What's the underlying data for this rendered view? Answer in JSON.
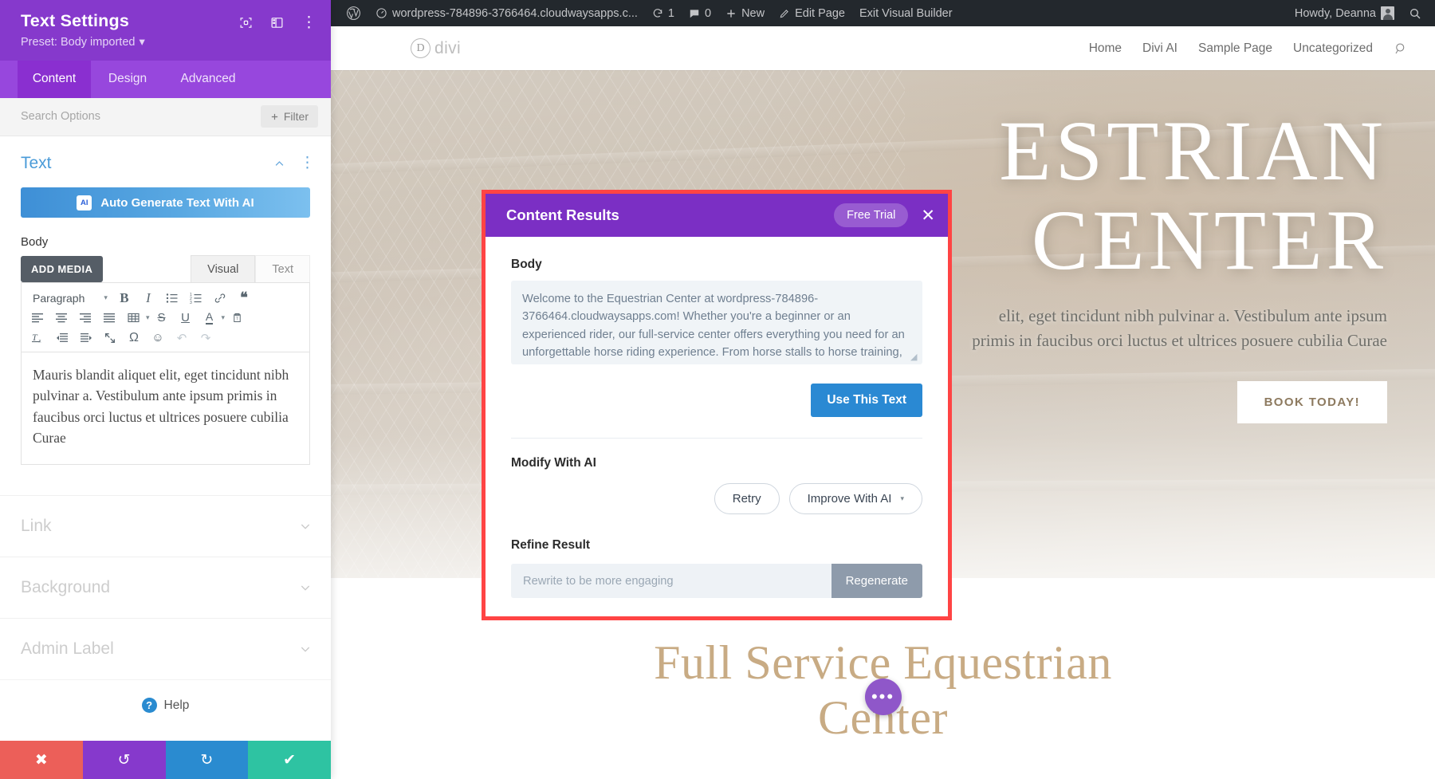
{
  "wp_adminbar": {
    "logo_icon": "wordpress-icon",
    "site_icon": "dashboard-icon",
    "site_name": "wordpress-784896-3766464.cloudwaysapps.c...",
    "updates_icon": "updates-icon",
    "updates_count": "1",
    "comments_icon": "comment-icon",
    "comments_count": "0",
    "new_icon": "plus-icon",
    "new_label": "New",
    "edit_icon": "pencil-icon",
    "edit_label": "Edit Page",
    "exit_label": "Exit Visual Builder",
    "howdy": "Howdy, Deanna",
    "avatar_icon": "avatar",
    "search_icon": "search-icon"
  },
  "site": {
    "logo_mark": "D",
    "logo_text": "divi",
    "nav": [
      {
        "label": "Home"
      },
      {
        "label": "Divi AI"
      },
      {
        "label": "Sample Page"
      },
      {
        "label": "Uncategorized"
      }
    ],
    "search_icon": "search-icon"
  },
  "hero": {
    "title_line1": "ESTRIAN",
    "title_line2": "CENTER",
    "subtitle_line1": "elit, eget tincidunt nibh pulvinar a. Vestibulum ante ipsum",
    "subtitle_line2": "primis in faucibus orci luctus et ultrices posuere cubilia Curae",
    "button_label": "BOOK TODAY!"
  },
  "lower_section": {
    "heading_line1": "Full Service Equestrian",
    "heading_line2": "Center",
    "fab_icon": "divi-menu-icon",
    "fab_label": "•••"
  },
  "panel": {
    "title": "Text Settings",
    "preset": "Preset: Body imported",
    "preset_caret": "▾",
    "head_icons": [
      {
        "name": "focus-target-icon"
      },
      {
        "name": "layout-columns-icon"
      },
      {
        "name": "vertical-dots-icon",
        "glyph": "⋮"
      }
    ],
    "tabs": [
      {
        "label": "Content",
        "active": true
      },
      {
        "label": "Design",
        "active": false
      },
      {
        "label": "Advanced",
        "active": false
      }
    ],
    "search_placeholder": "Search Options",
    "filter_label": "Filter",
    "filter_icon": "plus-icon",
    "section": {
      "title": "Text",
      "collapse_icon": "chevron-up-icon",
      "menu_icon": "vertical-dots-icon"
    },
    "ai_button": {
      "label": "Auto Generate Text With AI",
      "chip": "AI"
    },
    "body_field": {
      "label": "Body",
      "add_media_label": "ADD MEDIA",
      "tabs": [
        {
          "label": "Visual",
          "active": true
        },
        {
          "label": "Text",
          "active": false
        }
      ],
      "toolbar_row1": [
        {
          "name": "paragraph-format-select",
          "label": "Paragraph",
          "caret": "▾"
        },
        {
          "name": "bold-icon",
          "glyph": "B"
        },
        {
          "name": "italic-icon",
          "glyph": "I"
        },
        {
          "name": "bulleted-list-icon"
        },
        {
          "name": "numbered-list-icon"
        },
        {
          "name": "link-icon"
        },
        {
          "name": "blockquote-icon",
          "glyph": "❝"
        }
      ],
      "toolbar_row2": [
        {
          "name": "align-left-icon"
        },
        {
          "name": "align-center-icon"
        },
        {
          "name": "align-right-icon"
        },
        {
          "name": "align-justify-icon"
        },
        {
          "name": "table-icon",
          "caret": "▾"
        },
        {
          "name": "strikethrough-icon",
          "glyph": "S"
        },
        {
          "name": "underline-icon",
          "glyph": "U"
        },
        {
          "name": "text-color-icon",
          "glyph": "A",
          "caret": "▾"
        },
        {
          "name": "paste-as-text-icon"
        }
      ],
      "toolbar_row3": [
        {
          "name": "clear-formatting-icon"
        },
        {
          "name": "outdent-icon"
        },
        {
          "name": "indent-icon"
        },
        {
          "name": "fullscreen-icon"
        },
        {
          "name": "special-character-icon",
          "glyph": "Ω"
        },
        {
          "name": "emoji-icon",
          "glyph": "☺"
        },
        {
          "name": "undo-icon",
          "glyph": "↶"
        },
        {
          "name": "redo-icon",
          "glyph": "↷"
        }
      ],
      "content": "Mauris blandit aliquet elit, eget tincidunt nibh pulvinar a. Vestibulum ante ipsum primis in faucibus orci luctus et ultrices posuere cubilia Curae"
    },
    "collapsed_sections": [
      {
        "label": "Link",
        "caret": "⌄"
      },
      {
        "label": "Background",
        "caret": "⌄"
      },
      {
        "label": "Admin Label",
        "caret": "⌄"
      }
    ],
    "help": {
      "label": "Help",
      "icon": "question-circle-icon"
    },
    "footer_buttons": [
      {
        "name": "discard-button",
        "glyph": "✖",
        "color": "#ec5f59"
      },
      {
        "name": "undo-button",
        "glyph": "↺",
        "color": "#8639cc"
      },
      {
        "name": "redo-button",
        "glyph": "↻",
        "color": "#2a8bd0"
      },
      {
        "name": "save-button",
        "glyph": "✔",
        "color": "#2ec3a2"
      }
    ]
  },
  "modal": {
    "title": "Content Results",
    "free_trial_label": "Free Trial",
    "close_icon": "close-icon",
    "body_label": "Body",
    "body_text": "Welcome to the Equestrian Center at wordpress-784896-3766464.cloudwaysapps.com! Whether you're a beginner or an experienced rider, our full-service center offers everything you need for an unforgettable horse riding experience. From horse stalls to horse training, we have it all. Our team of expert coaches is dedicated to providing pure elegance and perfect training, making riding accessible",
    "use_this_text_label": "Use This Text",
    "modify_label": "Modify With AI",
    "retry_label": "Retry",
    "improve_label": "Improve With AI",
    "improve_caret": "▾",
    "refine_label": "Refine Result",
    "refine_placeholder": "Rewrite to be more engaging",
    "regenerate_label": "Regenerate",
    "outline_color": "#ff4444",
    "header_color": "#7b2fc4"
  }
}
